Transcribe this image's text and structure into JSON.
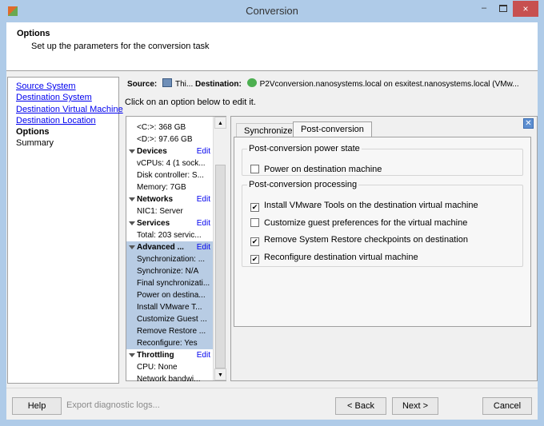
{
  "window": {
    "title": "Conversion",
    "close_label": "×"
  },
  "header": {
    "title": "Options",
    "subtitle": "Set up the parameters for the conversion task"
  },
  "nav": {
    "items": [
      {
        "label": "Source System",
        "type": "link"
      },
      {
        "label": "Destination System",
        "type": "link"
      },
      {
        "label": "Destination Virtual Machine",
        "type": "link"
      },
      {
        "label": "Destination Location",
        "type": "link"
      },
      {
        "label": "Options",
        "type": "current"
      },
      {
        "label": "Summary",
        "type": "plain"
      }
    ]
  },
  "summary": {
    "source_label": "Source:",
    "source_value": "Thi...",
    "destination_label": "Destination:",
    "destination_value": "P2Vconversion.nanosystems.local on esxitest.nanosystems.local (VMw...",
    "hint": "Click on an option below to edit it."
  },
  "tree": {
    "edit_label": "Edit",
    "rows": [
      {
        "text": "<C:>: 368 GB"
      },
      {
        "text": "<D:>: 97.66 GB"
      },
      {
        "text": "Devices",
        "head": true
      },
      {
        "text": "vCPUs: 4 (1 sock..."
      },
      {
        "text": "Disk controller: S..."
      },
      {
        "text": "Memory: 7GB"
      },
      {
        "text": "Networks",
        "head": true
      },
      {
        "text": "NIC1: Server"
      },
      {
        "text": "Services",
        "head": true
      },
      {
        "text": "Total: 203 servic..."
      },
      {
        "text": "Advanced ...",
        "head": true,
        "selected": true
      },
      {
        "text": "Synchronization: ...",
        "selected": true
      },
      {
        "text": "Synchronize: N/A",
        "selected": true
      },
      {
        "text": "Final synchronizati...",
        "selected": true
      },
      {
        "text": "Power on destina...",
        "selected": true
      },
      {
        "text": "Install VMware T...",
        "selected": true
      },
      {
        "text": "Customize Guest ...",
        "selected": true
      },
      {
        "text": "Remove Restore ...",
        "selected": true
      },
      {
        "text": "Reconfigure: Yes",
        "selected": true
      },
      {
        "text": "Throttling",
        "head": true
      },
      {
        "text": "CPU: None"
      },
      {
        "text": "Network bandwi..."
      }
    ]
  },
  "tabs": {
    "items": [
      "Synchronize",
      "Post-conversion"
    ],
    "active": "Post-conversion"
  },
  "post_conversion": {
    "power_group": {
      "title": "Post-conversion power state",
      "options": [
        {
          "label": "Power on destination machine",
          "checked": false
        }
      ]
    },
    "processing_group": {
      "title": "Post-conversion processing",
      "options": [
        {
          "label": "Install VMware Tools on the destination virtual machine",
          "checked": true
        },
        {
          "label": "Customize guest preferences for the virtual machine",
          "checked": false
        },
        {
          "label": "Remove System Restore checkpoints on destination",
          "checked": true
        },
        {
          "label": "Reconfigure destination virtual machine",
          "checked": true
        }
      ]
    }
  },
  "footer": {
    "help": "Help",
    "export": "Export diagnostic logs...",
    "back": "< Back",
    "next": "Next >",
    "cancel": "Cancel"
  }
}
